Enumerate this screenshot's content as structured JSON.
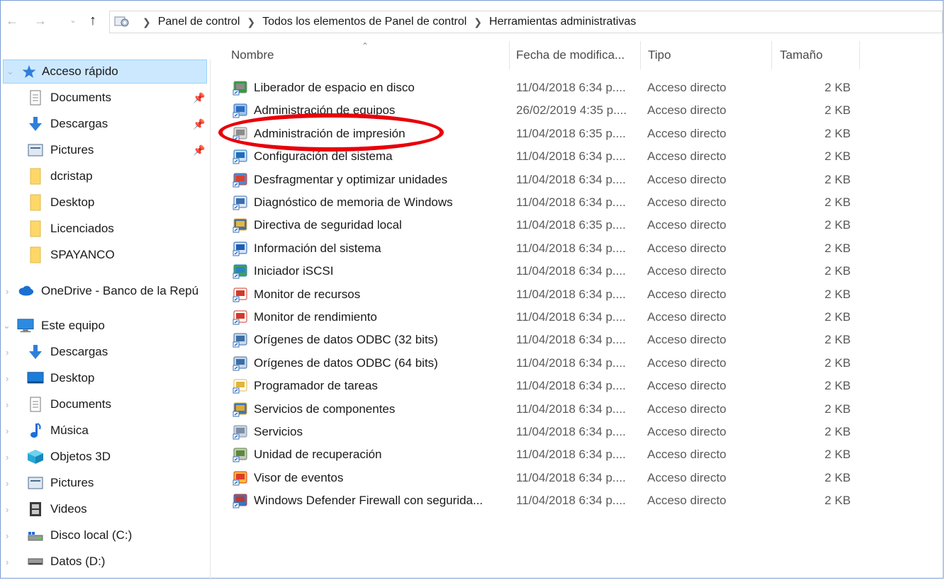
{
  "address": {
    "crumbs": [
      "Panel de control",
      "Todos los elementos de Panel de control",
      "Herramientas administrativas"
    ]
  },
  "sidebar": {
    "items": [
      {
        "label": "Acceso rápido",
        "icon": "star-icon",
        "level": 0,
        "selected": true
      },
      {
        "label": "Documents",
        "icon": "document-icon",
        "level": 1,
        "pinned": true
      },
      {
        "label": "Descargas",
        "icon": "download-icon",
        "level": 1,
        "pinned": true
      },
      {
        "label": "Pictures",
        "icon": "pictures-icon",
        "level": 1,
        "pinned": true
      },
      {
        "label": "dcristap",
        "icon": "folder-icon",
        "level": 1
      },
      {
        "label": "Desktop",
        "icon": "folder-icon",
        "level": 1
      },
      {
        "label": "Licenciados",
        "icon": "folder-icon",
        "level": 1
      },
      {
        "label": "SPAYANCO",
        "icon": "folder-icon",
        "level": 1
      },
      {
        "label": "OneDrive - Banco de la Repú",
        "icon": "cloud-icon",
        "level": 0
      },
      {
        "label": "Este equipo",
        "icon": "computer-icon",
        "level": 0
      },
      {
        "label": "Descargas",
        "icon": "download-icon",
        "level": 1
      },
      {
        "label": "Desktop",
        "icon": "desktop-icon",
        "level": 1
      },
      {
        "label": "Documents",
        "icon": "document-icon",
        "level": 1
      },
      {
        "label": "Música",
        "icon": "music-icon",
        "level": 1
      },
      {
        "label": "Objetos 3D",
        "icon": "cube-icon",
        "level": 1
      },
      {
        "label": "Pictures",
        "icon": "pictures-icon",
        "level": 1
      },
      {
        "label": "Videos",
        "icon": "video-icon",
        "level": 1
      },
      {
        "label": "Disco local (C:)",
        "icon": "disk-icon",
        "level": 1
      },
      {
        "label": "Datos (D:)",
        "icon": "drive-icon",
        "level": 1
      }
    ]
  },
  "columns": {
    "name": "Nombre",
    "date": "Fecha de modifica...",
    "type": "Tipo",
    "size": "Tamaño"
  },
  "files": [
    {
      "name": "Liberador de espacio en disco",
      "date": "11/04/2018 6:34 p....",
      "type": "Acceso directo",
      "size": "2 KB",
      "icon": "disk-cleanup-icon"
    },
    {
      "name": "Administración de equipos",
      "date": "26/02/2019 4:35 p....",
      "type": "Acceso directo",
      "size": "2 KB",
      "icon": "computer-management-icon"
    },
    {
      "name": "Administración de impresión",
      "date": "11/04/2018 6:35 p....",
      "type": "Acceso directo",
      "size": "2 KB",
      "icon": "printer-icon"
    },
    {
      "name": "Configuración del sistema",
      "date": "11/04/2018 6:34 p....",
      "type": "Acceso directo",
      "size": "2 KB",
      "icon": "system-config-icon"
    },
    {
      "name": "Desfragmentar y optimizar unidades",
      "date": "11/04/2018 6:34 p....",
      "type": "Acceso directo",
      "size": "2 KB",
      "icon": "defrag-icon"
    },
    {
      "name": "Diagnóstico de memoria de Windows",
      "date": "11/04/2018 6:34 p....",
      "type": "Acceso directo",
      "size": "2 KB",
      "icon": "memory-icon"
    },
    {
      "name": "Directiva de seguridad local",
      "date": "11/04/2018 6:35 p....",
      "type": "Acceso directo",
      "size": "2 KB",
      "icon": "security-policy-icon"
    },
    {
      "name": "Información del sistema",
      "date": "11/04/2018 6:34 p....",
      "type": "Acceso directo",
      "size": "2 KB",
      "icon": "system-info-icon"
    },
    {
      "name": "Iniciador iSCSI",
      "date": "11/04/2018 6:34 p....",
      "type": "Acceso directo",
      "size": "2 KB",
      "icon": "iscsi-icon"
    },
    {
      "name": "Monitor de recursos",
      "date": "11/04/2018 6:34 p....",
      "type": "Acceso directo",
      "size": "2 KB",
      "icon": "resource-monitor-icon"
    },
    {
      "name": "Monitor de rendimiento",
      "date": "11/04/2018 6:34 p....",
      "type": "Acceso directo",
      "size": "2 KB",
      "icon": "performance-monitor-icon"
    },
    {
      "name": "Orígenes de datos ODBC (32 bits)",
      "date": "11/04/2018 6:34 p....",
      "type": "Acceso directo",
      "size": "2 KB",
      "icon": "odbc-icon"
    },
    {
      "name": "Orígenes de datos ODBC (64 bits)",
      "date": "11/04/2018 6:34 p....",
      "type": "Acceso directo",
      "size": "2 KB",
      "icon": "odbc-icon"
    },
    {
      "name": "Programador de tareas",
      "date": "11/04/2018 6:34 p....",
      "type": "Acceso directo",
      "size": "2 KB",
      "icon": "task-scheduler-icon"
    },
    {
      "name": "Servicios de componentes",
      "date": "11/04/2018 6:34 p....",
      "type": "Acceso directo",
      "size": "2 KB",
      "icon": "component-services-icon"
    },
    {
      "name": "Servicios",
      "date": "11/04/2018 6:34 p....",
      "type": "Acceso directo",
      "size": "2 KB",
      "icon": "services-icon"
    },
    {
      "name": "Unidad de recuperación",
      "date": "11/04/2018 6:34 p....",
      "type": "Acceso directo",
      "size": "2 KB",
      "icon": "recovery-drive-icon"
    },
    {
      "name": "Visor de eventos",
      "date": "11/04/2018 6:34 p....",
      "type": "Acceso directo",
      "size": "2 KB",
      "icon": "event-viewer-icon"
    },
    {
      "name": "Windows Defender Firewall con segurida...",
      "date": "11/04/2018 6:34 p....",
      "type": "Acceso directo",
      "size": "2 KB",
      "icon": "firewall-icon"
    }
  ],
  "colors": {
    "selection": "#cce8ff",
    "selection_border": "#99d1ff",
    "annotation": "#e8000a",
    "folder": "#ffd767",
    "accent_blue": "#1e6fd9"
  }
}
